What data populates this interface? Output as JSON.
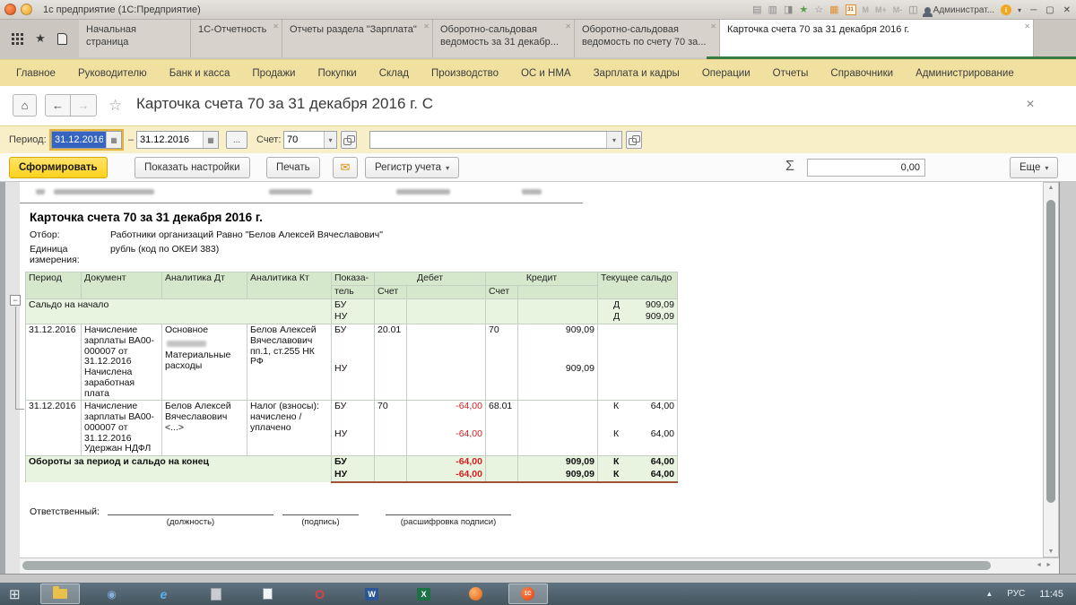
{
  "titlebar": {
    "title": "1с предприятие (1С:Предприятие)",
    "user": "Администрат...",
    "mem_m": "M",
    "mem_mplus": "M+",
    "mem_mminus": "M-",
    "calendar_day": "31",
    "info_i": "i"
  },
  "tabs": [
    {
      "label": "Начальная страница",
      "closable": false,
      "active": false
    },
    {
      "label": "1С-Отчетность",
      "closable": true,
      "active": false
    },
    {
      "label": "Отчеты раздела \"Зарплата\"",
      "closable": true,
      "active": false
    },
    {
      "label": "Оборотно-сальдовая ведомость за 31 декабр...",
      "closable": true,
      "active": false
    },
    {
      "label": "Оборотно-сальдовая ведомость по счету 70 за...",
      "closable": true,
      "active": false
    },
    {
      "label": "Карточка счета 70 за 31 декабря 2016 г.",
      "closable": true,
      "active": true
    }
  ],
  "menu": {
    "items": [
      "Главное",
      "Руководителю",
      "Банк и касса",
      "Продажи",
      "Покупки",
      "Склад",
      "Производство",
      "ОС и НМА",
      "Зарплата и кадры",
      "Операции",
      "Отчеты",
      "Справочники",
      "Администрирование"
    ]
  },
  "nav": {
    "title": "Карточка счета 70 за 31 декабря 2016 г. С"
  },
  "filters": {
    "period_label": "Период:",
    "period_from": "31.12.2016",
    "range_dash": "–",
    "period_to": "31.12.2016",
    "more_button": "...",
    "account_label": "Счет:",
    "account_value": "70"
  },
  "actions": {
    "generate": "Сформировать",
    "settings": "Показать настройки",
    "print": "Печать",
    "register": "Регистр учета",
    "sum_sign": "Σ",
    "sum_value": "0,00",
    "more": "Еще"
  },
  "report": {
    "title": "Карточка счета 70 за 31 декабря 2016 г.",
    "filter_label": "Отбор:",
    "filter_value": "Работники организаций Равно \"Белов Алексей Вячеславович\"",
    "unit_label": "Единица измерения:",
    "unit_value": "рубль (код по ОКЕИ 383)",
    "table": {
      "headers": {
        "period": "Период",
        "document": "Документ",
        "an_dt": "Аналитика Дт",
        "an_kt": "Аналитика Кт",
        "indicator1": "Показа-",
        "indicator2": "тель",
        "debit": "Дебет",
        "credit": "Кредит",
        "account_dt": "Счет",
        "account_kt": "Счет",
        "saldo": "Текущее сальдо"
      },
      "opening": {
        "label": "Сальдо на начало",
        "bu_label": "БУ",
        "nu_label": "НУ",
        "bu_side": "Д",
        "bu_amount": "909,09",
        "nu_side": "Д",
        "nu_amount": "909,09"
      },
      "rows": [
        {
          "period": "31.12.2016",
          "document": "Начисление зарплаты ВА00-000007 от 31.12.2016 Начислена заработная плата",
          "an_dt_1": "Основное",
          "an_dt_2": "Материальные расходы",
          "an_kt": "Белов Алексей Вячеславович пп.1, ст.255 НК РФ",
          "bu_label": "БУ",
          "nu_label": "НУ",
          "bu_debit_account": "20.01",
          "bu_credit_account": "70",
          "bu_credit": "909,09",
          "nu_credit": "909,09"
        },
        {
          "period": "31.12.2016",
          "document": "Начисление зарплаты ВА00-000007 от 31.12.2016 Удержан НДФЛ",
          "an_dt": "Белов Алексей Вячеславович <...>",
          "an_kt": "Налог (взносы): начислено / уплачено",
          "bu_label": "БУ",
          "nu_label": "НУ",
          "bu_debit_account": "70",
          "bu_debit": "-64,00",
          "bu_credit_account": "68.01",
          "bu_saldo_side": "К",
          "bu_saldo": "64,00",
          "nu_debit": "-64,00",
          "nu_saldo_side": "К",
          "nu_saldo": "64,00"
        }
      ],
      "totals": {
        "label": "Обороты за период и сальдо на конец",
        "bu_label": "БУ",
        "nu_label": "НУ",
        "bu_debit": "-64,00",
        "bu_credit": "909,09",
        "bu_saldo_side": "К",
        "bu_saldo": "64,00",
        "nu_debit": "-64,00",
        "nu_credit": "909,09",
        "nu_saldo_side": "К",
        "nu_saldo": "64,00"
      }
    },
    "signature": {
      "label": "Ответственный:",
      "caption1": "(должность)",
      "caption2": "(подпись)",
      "caption3": "(расшифровка подписи)"
    }
  },
  "taskbar": {
    "lang": "РУС",
    "time": "11:45"
  },
  "icons": {
    "home": "⌂",
    "back": "←",
    "forward": "→",
    "star_outline": "☆",
    "star": "★",
    "close": "✕",
    "dropdown": "▾",
    "calendar_grid": "▦",
    "envelope": "✉",
    "save": "▤",
    "print": "▥",
    "preview": "◨",
    "calc": "▦",
    "split": "◫",
    "minimize": "─",
    "restore": "▢",
    "up": "▲",
    "down": "▼",
    "left": "◄",
    "right": "►",
    "start": "⊞",
    "minus": "−",
    "ie": "e",
    "opera": "O",
    "word": "W",
    "excel": "X",
    "eye": "◉",
    "onec": "1С"
  },
  "colors": {
    "accent_yellow": "#ffd21e",
    "menu_yellow": "#f1e1a0",
    "header_green": "#d6e8cc",
    "row_green": "#e8f3e0",
    "negative_red": "#cc2222",
    "active_tab_underline": "#3a7a44",
    "taskbar": "#51626e",
    "selection_blue": "#3565c0"
  }
}
